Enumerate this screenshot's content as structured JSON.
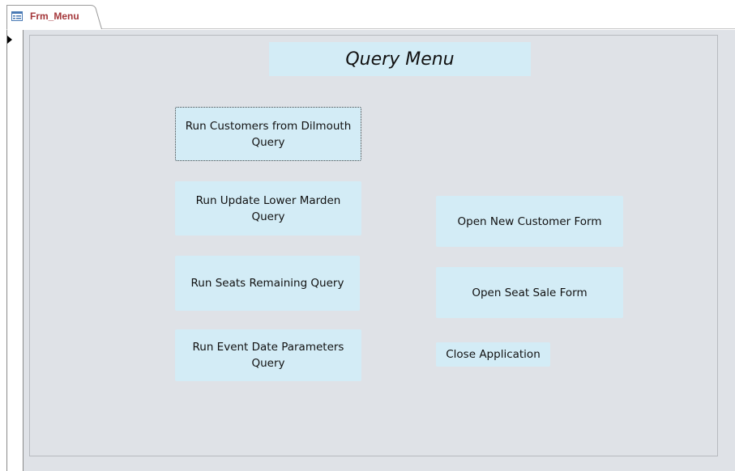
{
  "tab": {
    "label": "Frm_Menu",
    "icon": "form-icon"
  },
  "form": {
    "title": "Query Menu",
    "buttons": {
      "run_customers_dilmouth": "Run Customers from Dilmouth Query",
      "run_update_lower_marden": "Run Update Lower Marden Query",
      "run_seats_remaining": "Run Seats Remaining Query",
      "run_event_date_parameters": "Run Event Date Parameters Query",
      "open_new_customer_form": "Open New Customer Form",
      "open_seat_sale_form": "Open Seat Sale Form",
      "close_application": "Close Application"
    }
  },
  "colors": {
    "tab_label": "#a4373a",
    "form_background": "#dfe2e7",
    "button_background": "#d3ecf6"
  }
}
